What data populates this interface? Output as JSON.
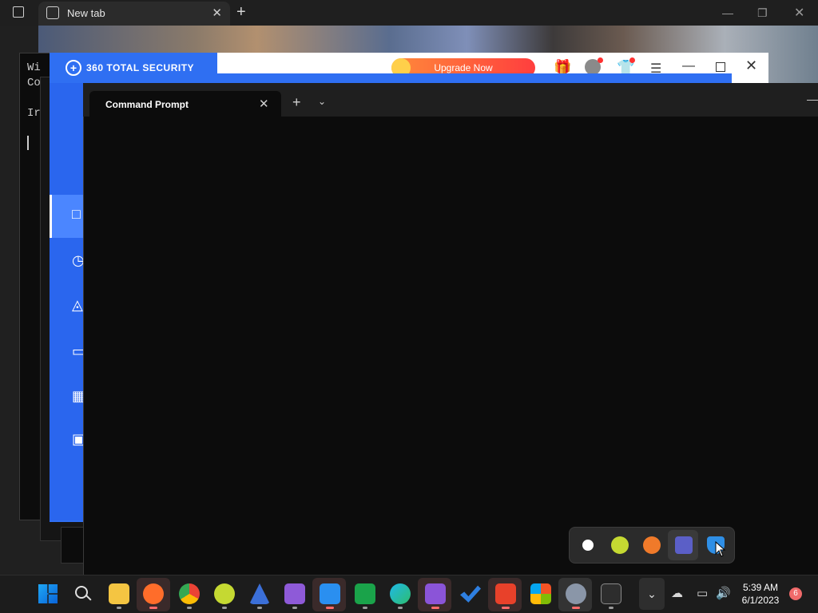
{
  "browser": {
    "tab_title": "New tab",
    "new_tab_label": "+",
    "close_label": "✕"
  },
  "console": {
    "text": "Wi\nCo\n\nIr"
  },
  "total_security": {
    "title": "360 TOTAL SECURITY",
    "logo_glyph": "+",
    "upgrade_label": "Upgrade Now",
    "gift_glyph": "🎁",
    "shirt_glyph": "👕",
    "menu_glyph": "☰",
    "minimize_glyph": "—",
    "close_glyph": "✕",
    "sidebar_icons": [
      "□",
      "◷",
      "◬",
      "▭",
      "▦",
      "▣"
    ]
  },
  "terminal": {
    "tab_title": "Command Prompt",
    "close_glyph": "✕",
    "new_tab_glyph": "+",
    "dropdown_glyph": "⌄",
    "minimize_glyph": "—"
  },
  "tray_popup": {
    "icons": [
      "xbox-icon",
      "plus-icon",
      "orange-app-icon",
      "teams-icon",
      "security-shield-icon"
    ]
  },
  "taskbar": {
    "clock_time": "5:39 AM",
    "clock_date": "6/1/2023",
    "notification_count": "6",
    "chevron_glyph": "⌄"
  }
}
